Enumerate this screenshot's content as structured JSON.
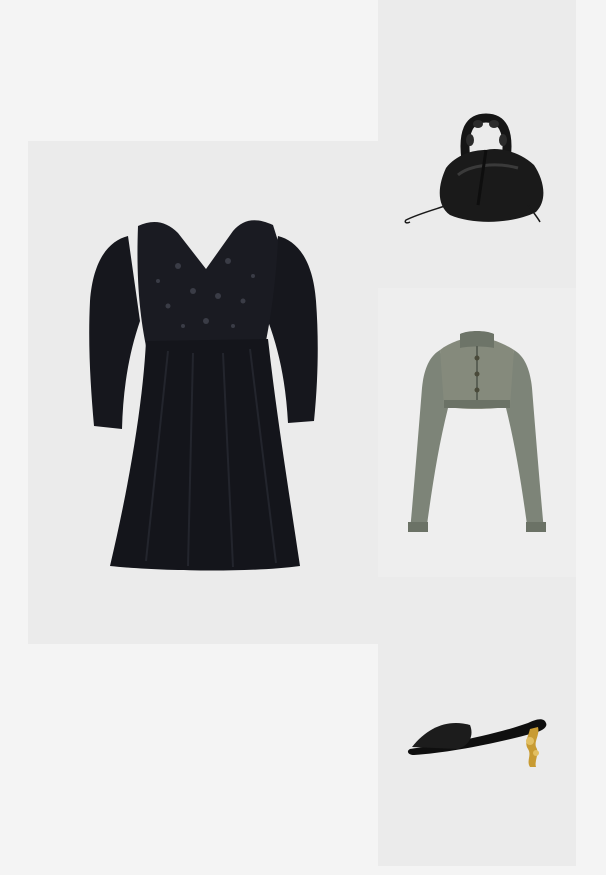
{
  "outfit": {
    "items": [
      {
        "key": "dress",
        "icon": "black-mini-dress-image"
      },
      {
        "key": "bag",
        "icon": "black-leather-bucket-bag-image"
      },
      {
        "key": "jacket",
        "icon": "cropped-denim-jacket-image"
      },
      {
        "key": "mule",
        "icon": "black-heeled-mule-image"
      }
    ],
    "colors": {
      "background": "#f4f4f4",
      "panel": "#ebebeb",
      "dress": "#14151b",
      "bag": "#1a1a1a",
      "denim": "#7d8478",
      "gold": "#c89b32"
    }
  }
}
